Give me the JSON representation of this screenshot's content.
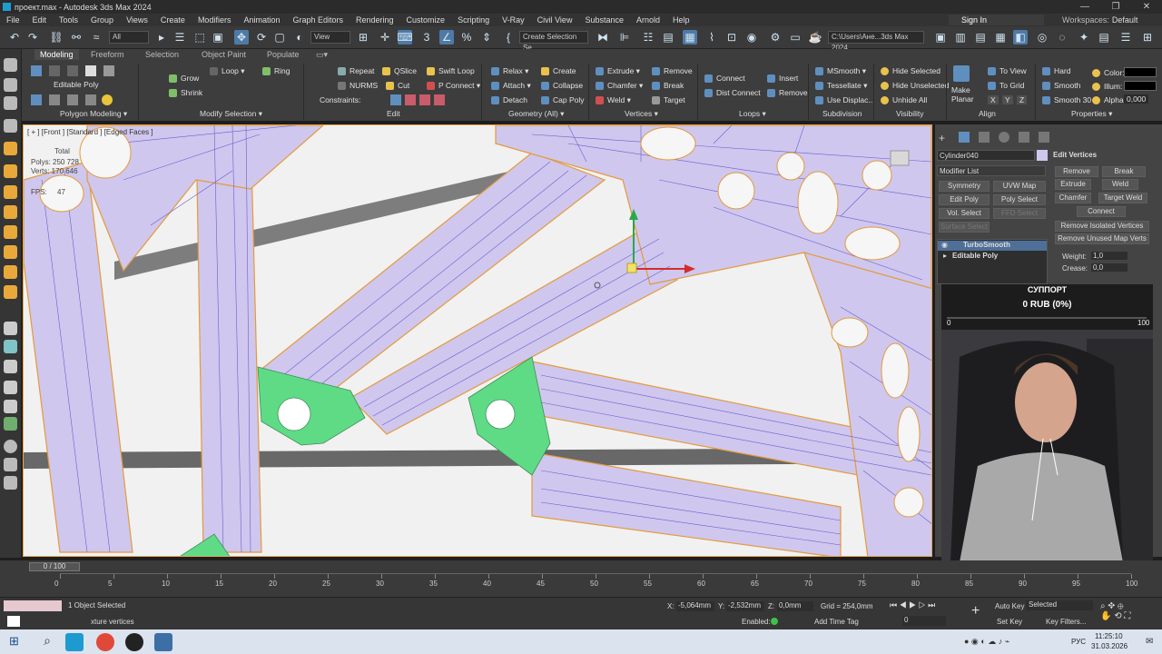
{
  "window": {
    "title": "проект.max - Autodesk 3ds Max 2024",
    "controls": [
      "—",
      "❐",
      "✕"
    ]
  },
  "menu": {
    "items": [
      "File",
      "Edit",
      "Tools",
      "Group",
      "Views",
      "Create",
      "Modifiers",
      "Animation",
      "Graph Editors",
      "Rendering",
      "Customize",
      "Scripting",
      "V-Ray",
      "Civil View",
      "Substance",
      "Arnold",
      "Help"
    ],
    "sign_in": "Sign In",
    "workspaces_label": "Workspaces:",
    "workspace_value": "Default"
  },
  "toolbar": {
    "filter_select": "All",
    "view_select": "View",
    "selection_set": "Create Selection Se",
    "path": "C:\\Users\\Ане...3ds Max 2024"
  },
  "ribbon": {
    "tabs": [
      "Modeling",
      "Freeform",
      "Selection",
      "Object Paint",
      "Populate"
    ],
    "editable_poly": "Editable Poly",
    "groups": {
      "polygon_modeling": "Polygon Modeling ▾",
      "modify_selection": "Modify Selection ▾",
      "edit": "Edit",
      "geometry": "Geometry (All) ▾",
      "vertices": "Vertices ▾",
      "loops": "Loops ▾",
      "subdivision": "Subdivision",
      "visibility": "Visibility",
      "align": "Align",
      "properties": "Properties ▾"
    },
    "modify": {
      "grow": "Grow",
      "shrink": "Shrink",
      "loop": "Loop ▾",
      "ring": "Ring"
    },
    "edit": {
      "repeat": "Repeat",
      "qslice": "QSlice",
      "swift_loop": "Swift Loop",
      "nurms": "NURMS",
      "cut": "Cut",
      "p_connect": "P Connect ▾",
      "constraints": "Constraints:"
    },
    "geometry": {
      "relax": "Relax ▾",
      "create": "Create",
      "attach": "Attach ▾",
      "collapse": "Collapse",
      "detach": "Detach",
      "cap_poly": "Cap Poly"
    },
    "vertices": {
      "extrude": "Extrude ▾",
      "remove": "Remove",
      "chamfer": "Chamfer ▾",
      "break": "Break",
      "weld": "Weld ▾",
      "target": "Target"
    },
    "loops": {
      "connect": "Connect",
      "dist_connect": "Dist Connect",
      "insert": "Insert",
      "remove": "Remove"
    },
    "subdivision": {
      "msmooth": "MSmooth ▾",
      "tessellate": "Tessellate ▾",
      "use_displac": "Use Displac..."
    },
    "visibility": {
      "hide_selected": "Hide Selected",
      "hide_unselected": "Hide Unselected",
      "unhide_all": "Unhide All"
    },
    "align": {
      "make_planar": "Make Planar",
      "to_view": "To View",
      "to_grid": "To Grid",
      "x": "X",
      "y": "Y",
      "z": "Z"
    },
    "properties": {
      "hard": "Hard",
      "smooth": "Smooth",
      "smooth30": "Smooth 30",
      "color": "Color:",
      "illum": "Illum:",
      "alpha": "Alpha:",
      "alpha_val": "0,000"
    }
  },
  "viewport": {
    "label": "[ + ] [Front ] [Standard ] [Edged Faces ]",
    "stats": {
      "total": "Total",
      "polys": "Polys: 250 728",
      "verts": "Verts: 170 646",
      "fps_label": "FPS:",
      "fps": "47"
    }
  },
  "command_panel": {
    "object_name": "Cylinder040",
    "modifier_list": "Modifier List",
    "buttons": [
      "Symmetry",
      "UVW Map",
      "Edit Poly",
      "Poly Select",
      "Vol. Select",
      "FFD Select",
      "Surface Select"
    ],
    "stack": [
      "TurboSmooth",
      "Editable Poly"
    ],
    "edit_vertices": {
      "title": "Edit Vertices",
      "remove": "Remove",
      "break": "Break",
      "extrude": "Extrude",
      "weld": "Weld",
      "chamfer": "Chamfer",
      "target_weld": "Target Weld",
      "connect": "Connect",
      "remove_isolated": "Remove Isolated Vertices",
      "remove_unused": "Remove Unused Map Verts",
      "weight_label": "Weight:",
      "weight": "1,0",
      "crease_label": "Crease:",
      "crease": "0,0"
    }
  },
  "support": {
    "title": "СУППОРТ",
    "amount": "0 RUB (0%)",
    "progress": 0,
    "min": "0",
    "max": "100"
  },
  "timeline": {
    "frame": "0 / 100",
    "ticks": [
      "0",
      "5",
      "10",
      "15",
      "20",
      "25",
      "30",
      "35",
      "40",
      "45",
      "50",
      "55",
      "60",
      "65",
      "70",
      "75",
      "80",
      "85",
      "90",
      "95",
      "100"
    ]
  },
  "status": {
    "selected": "1 Object Selected",
    "prompt": "xture vertices",
    "x_label": "X:",
    "x": "-5,064mm",
    "y_label": "Y:",
    "y": "-2,532mm",
    "z_label": "Z:",
    "z": "0,0mm",
    "grid": "Grid = 254,0mm",
    "enabled": "Enabled:",
    "add_time_tag": "Add Time Tag",
    "auto_key": "Auto Key",
    "set_key": "Set Key",
    "key_mode": "Selected",
    "key_filters": "Key Filters...",
    "frame_field": "0"
  },
  "taskbar": {
    "lang": "РУС",
    "time": "11:25:10",
    "date": "31.03.2026"
  },
  "colors": {
    "mesh": "#cfc7ee",
    "wire": "#6a5fcf",
    "edge": "#e49a3a",
    "selected": "#5fdb86"
  }
}
